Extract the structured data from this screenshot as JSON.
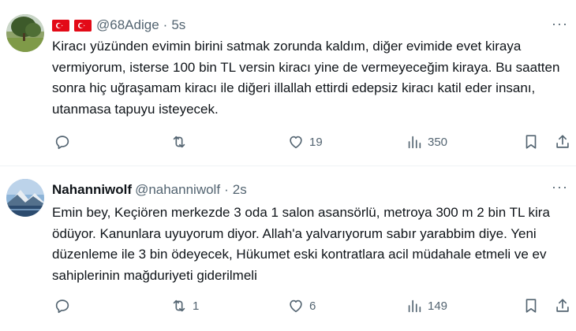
{
  "tweets": [
    {
      "name": "",
      "handle": "@68Adige",
      "separator": "·",
      "time": "5s",
      "more": "···",
      "text": "Kiracı yüzünden evimin birini satmak zorunda kaldım, diğer evimide evet kiraya vermiyorum, isterse 100 bin TL versin kiracı yine de vermeyeceğim kiraya. Bu saatten sonra hiç uğraşamam kiracı ile diğeri illallah ettirdi edepsiz kiracı katil eder insanı, utanmasa tapuyu isteyecek.",
      "replies": "",
      "retweets": "",
      "likes": "19",
      "views": "350",
      "flags": [
        "turkish-flag",
        "turkish-flag"
      ]
    },
    {
      "name": "Nahanniwolf",
      "handle": "@nahanniwolf",
      "separator": "·",
      "time": "2s",
      "more": "···",
      "text": "Emin bey, Keçiören merkezde 3 oda 1 salon asansörlü, metroya 300 m 2 bin TL kira ödüyor. Kanunlara uyuyorum diyor. Allah'a yalvarıyorum sabır yarabbim diye. Yeni düzenleme ile 3 bin ödeyecek, Hükumet eski kontratlara acil müdahale etmeli ve ev sahiplerinin mağduriyeti giderilmeli",
      "replies": "",
      "retweets": "1",
      "likes": "6",
      "views": "149"
    }
  ],
  "colors": {
    "text": "#0f1419",
    "secondary": "#536471",
    "flag_red": "#e30a17",
    "divider": "#eff3f4"
  }
}
